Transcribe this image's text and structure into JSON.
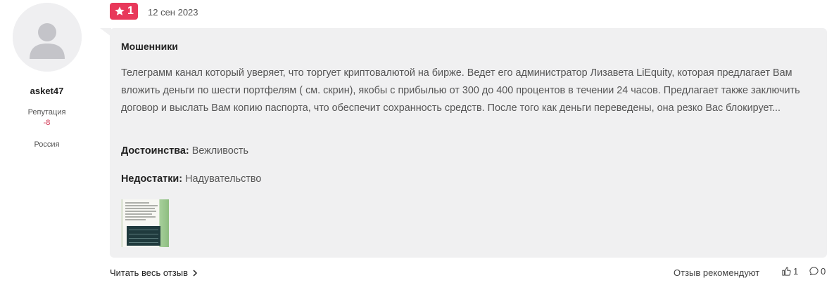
{
  "user": {
    "avatar_icon": "default-user-avatar-icon",
    "username": "asket47",
    "reputation_label": "Репутация",
    "reputation_value": "-8",
    "country": "Россия"
  },
  "review": {
    "rating": "1",
    "rating_icon": "star-icon",
    "rating_color": "#e8385a",
    "date": "12 сен 2023",
    "title": "Мошенники",
    "body": "Телеграмм канал который уверяет, что торгует криптовалютой на бирже. Ведет его администратор Лизавета LiEquity, которая предлагает Вам вложить деньги по шести портфелям ( см. скрин), якобы с прибылью от 300 до 400 процентов в течении 24 часов. Предлагает также заключить договор и выслать Вам копию паспорта, что обеспечит сохранность средств. После того как деньги переведены, она резко Вас блокирует...",
    "pros_label": "Достоинства:",
    "pros_value": "Вежливость",
    "cons_label": "Недостатки:",
    "cons_value": "Надувательство",
    "attachment_icon": "screenshot-thumbnail"
  },
  "footer": {
    "read_more_label": "Читать весь отзыв",
    "recommend_label": "Отзыв рекомендуют",
    "likes_count": "1",
    "comments_count": "0"
  }
}
